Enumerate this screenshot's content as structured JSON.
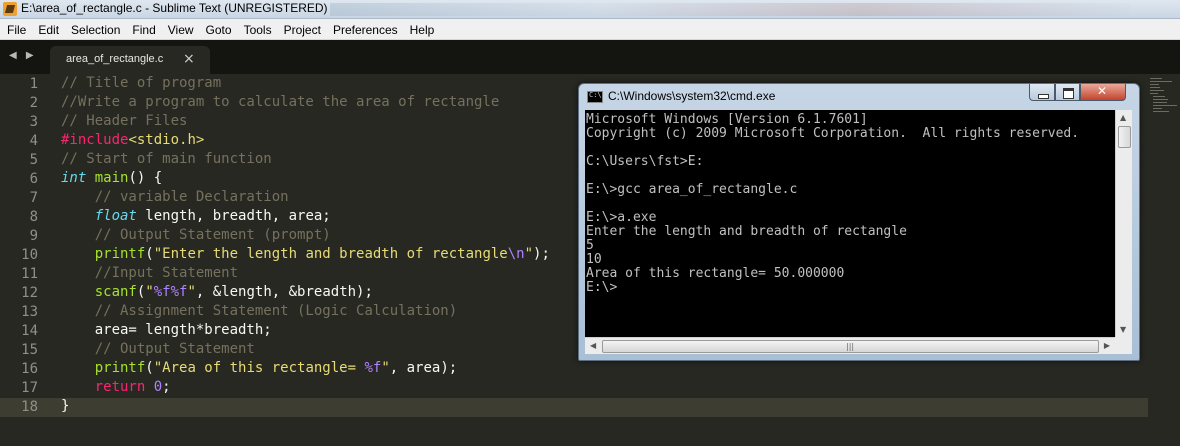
{
  "window": {
    "title": "E:\\area_of_rectangle.c - Sublime Text (UNREGISTERED)"
  },
  "menu": [
    "File",
    "Edit",
    "Selection",
    "Find",
    "View",
    "Goto",
    "Tools",
    "Project",
    "Preferences",
    "Help"
  ],
  "tab": {
    "label": "area_of_rectangle.c",
    "close": "×"
  },
  "nav_arrows": "◀ ▶",
  "editor": {
    "current_line": 18,
    "lines": [
      [
        {
          "t": "// Title of program",
          "c": "com"
        }
      ],
      [
        {
          "t": "//Write a program to calculate the area of rectangle",
          "c": "com"
        }
      ],
      [
        {
          "t": "// Header Files",
          "c": "com"
        }
      ],
      [
        {
          "t": "#include",
          "c": "kw"
        },
        {
          "t": "<stdio.h>",
          "c": "str"
        }
      ],
      [
        {
          "t": "// Start of main function",
          "c": "com"
        }
      ],
      [
        {
          "t": "int",
          "c": "type"
        },
        {
          "t": " "
        },
        {
          "t": "main",
          "c": "fn"
        },
        {
          "t": "() {"
        }
      ],
      [
        {
          "t": "    "
        },
        {
          "t": "// variable Declaration",
          "c": "com"
        }
      ],
      [
        {
          "t": "    "
        },
        {
          "t": "float",
          "c": "type"
        },
        {
          "t": " length, breadth, area;"
        }
      ],
      [
        {
          "t": "    "
        },
        {
          "t": "// Output Statement (prompt)",
          "c": "com"
        }
      ],
      [
        {
          "t": "    "
        },
        {
          "t": "printf",
          "c": "fn"
        },
        {
          "t": "("
        },
        {
          "t": "\"Enter the length and breadth of rectangle",
          "c": "str"
        },
        {
          "t": "\\n",
          "c": "esc"
        },
        {
          "t": "\"",
          "c": "str"
        },
        {
          "t": ");"
        }
      ],
      [
        {
          "t": "    "
        },
        {
          "t": "//Input Statement",
          "c": "com"
        }
      ],
      [
        {
          "t": "    "
        },
        {
          "t": "scanf",
          "c": "fn"
        },
        {
          "t": "("
        },
        {
          "t": "\"",
          "c": "str"
        },
        {
          "t": "%f%f",
          "c": "esc"
        },
        {
          "t": "\"",
          "c": "str"
        },
        {
          "t": ", &length, &breadth);"
        }
      ],
      [
        {
          "t": "    "
        },
        {
          "t": "// Assignment Statement (Logic Calculation)",
          "c": "com"
        }
      ],
      [
        {
          "t": "    area= length*breadth;"
        }
      ],
      [
        {
          "t": "    "
        },
        {
          "t": "// Output Statement",
          "c": "com"
        }
      ],
      [
        {
          "t": "    "
        },
        {
          "t": "printf",
          "c": "fn"
        },
        {
          "t": "("
        },
        {
          "t": "\"Area of this rectangle= ",
          "c": "str"
        },
        {
          "t": "%f",
          "c": "esc"
        },
        {
          "t": "\"",
          "c": "str"
        },
        {
          "t": ", area);"
        }
      ],
      [
        {
          "t": "    "
        },
        {
          "t": "return",
          "c": "kw"
        },
        {
          "t": " "
        },
        {
          "t": "0",
          "c": "num"
        },
        {
          "t": ";"
        }
      ],
      [
        {
          "t": "}"
        }
      ]
    ]
  },
  "cmd": {
    "title": "C:\\Windows\\system32\\cmd.exe",
    "grip": "|||",
    "output": [
      "Microsoft Windows [Version 6.1.7601]",
      "Copyright (c) 2009 Microsoft Corporation.  All rights reserved.",
      "",
      "C:\\Users\\fst>E:",
      "",
      "E:\\>gcc area_of_rectangle.c",
      "",
      "E:\\>a.exe",
      "Enter the length and breadth of rectangle",
      "5",
      "10",
      "Area of this rectangle= 50.000000",
      "E:\\>"
    ]
  },
  "colors": {
    "editor_bg": "#272822",
    "comment": "#75715e",
    "keyword": "#f92672",
    "type": "#66d9ef",
    "function": "#a6e22e",
    "string": "#e6db74",
    "number": "#ae81ff"
  }
}
